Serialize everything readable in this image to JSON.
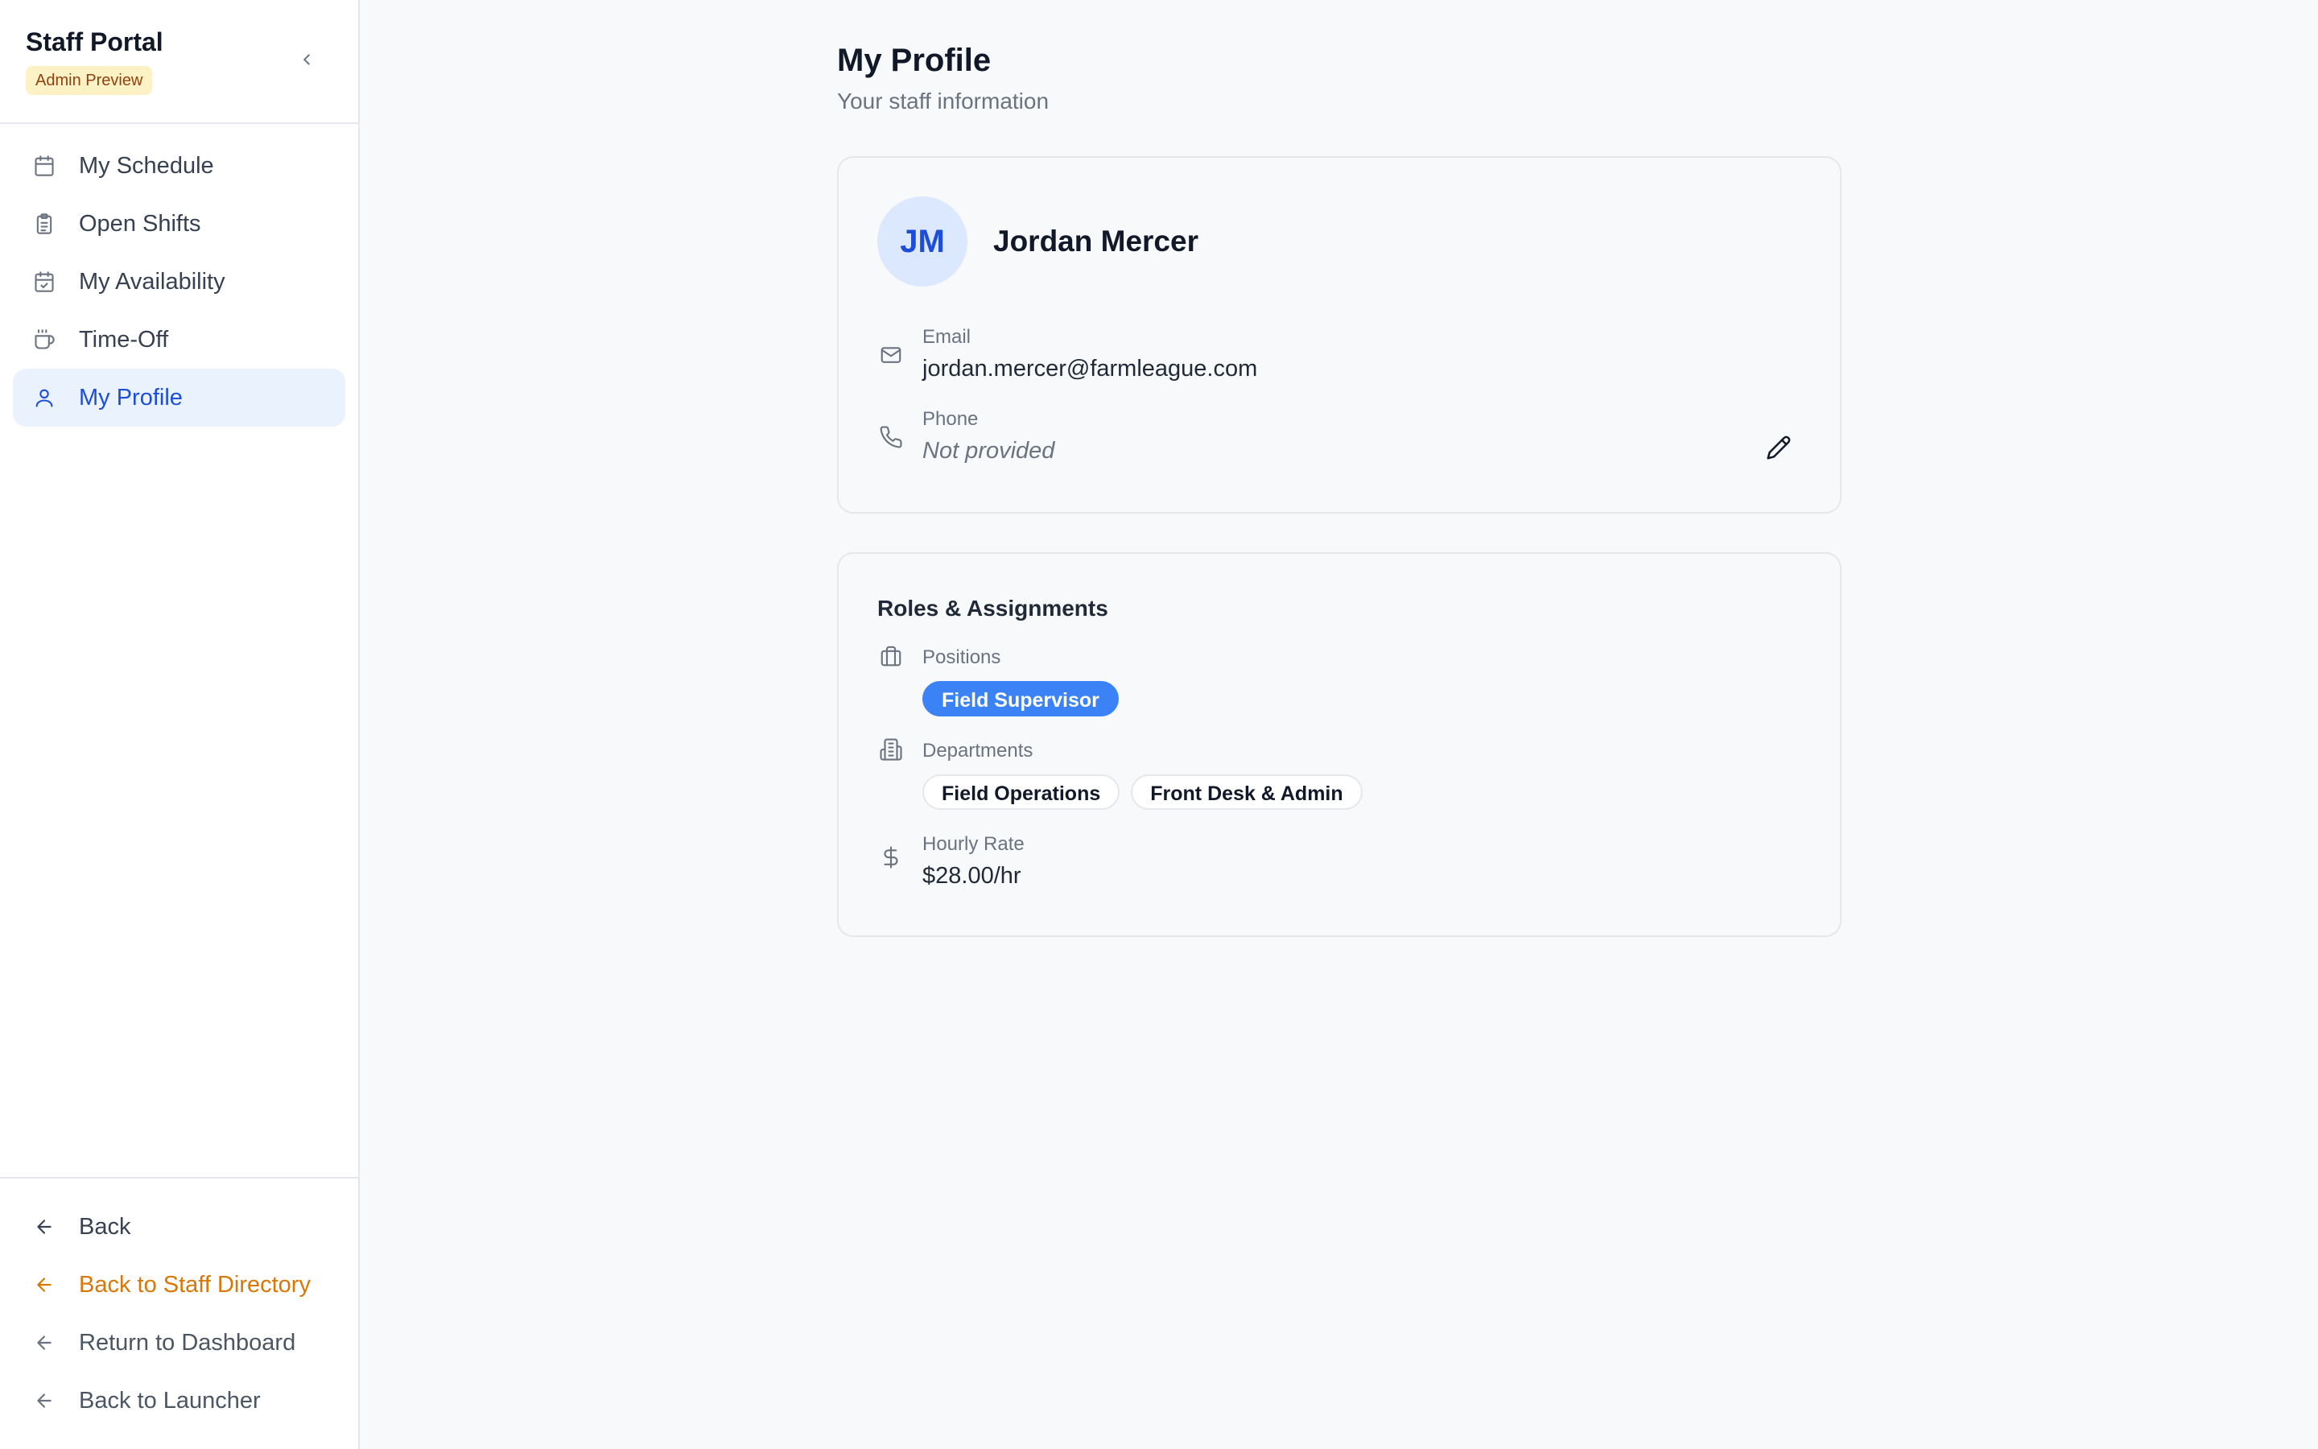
{
  "sidebar": {
    "title": "Staff Portal",
    "badge": "Admin Preview",
    "nav": [
      {
        "label": "My Schedule",
        "icon": "calendar-icon"
      },
      {
        "label": "Open Shifts",
        "icon": "clipboard-icon"
      },
      {
        "label": "My Availability",
        "icon": "calendar-check-icon"
      },
      {
        "label": "Time-Off",
        "icon": "coffee-icon"
      },
      {
        "label": "My Profile",
        "icon": "user-icon",
        "active": true
      }
    ],
    "footer": [
      {
        "label": "Back",
        "icon": "arrow-left-icon"
      },
      {
        "label": "Back to Staff Directory",
        "icon": "arrow-left-icon",
        "color": "#d97706"
      },
      {
        "label": "Return to Dashboard",
        "icon": "arrow-left-icon"
      },
      {
        "label": "Back to Launcher",
        "icon": "arrow-left-icon"
      }
    ]
  },
  "page": {
    "title": "My Profile",
    "subtitle": "Your staff information"
  },
  "profile": {
    "initials": "JM",
    "name": "Jordan Mercer",
    "email_label": "Email",
    "email": "jordan.mercer@farmleague.com",
    "phone_label": "Phone",
    "phone": "Not provided"
  },
  "roles": {
    "title": "Roles & Assignments",
    "positions_label": "Positions",
    "positions": [
      "Field Supervisor"
    ],
    "departments_label": "Departments",
    "departments": [
      "Field Operations",
      "Front Desk & Admin"
    ],
    "rate_label": "Hourly Rate",
    "rate": "$28.00/hr"
  },
  "colors": {
    "accent": "#3b82f6",
    "active_bg": "#eaf2fe",
    "active_text": "#1d4ed8",
    "badge_bg": "#fdf2c6",
    "warning": "#d97706"
  }
}
